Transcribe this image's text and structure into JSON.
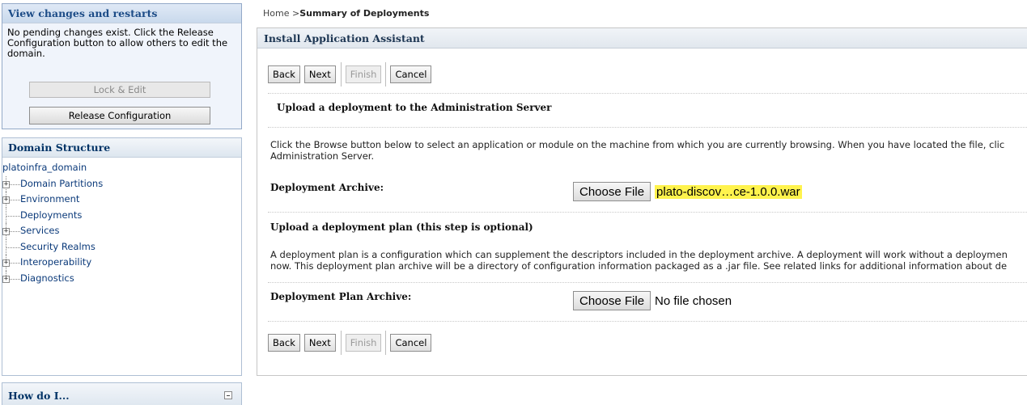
{
  "changes_panel": {
    "title": "View changes and restarts",
    "message_line1": "No pending changes exist. Click the Release",
    "message_line2": "Configuration button to allow others to edit the",
    "message_line3": "domain.",
    "lock_edit_label": "Lock & Edit",
    "release_label": "Release Configuration"
  },
  "domain_structure": {
    "title": "Domain Structure",
    "root": "platoinfra_domain",
    "items": [
      {
        "label": "Domain Partitions",
        "expandable": true
      },
      {
        "label": "Environment",
        "expandable": true
      },
      {
        "label": "Deployments",
        "expandable": false
      },
      {
        "label": "Services",
        "expandable": true
      },
      {
        "label": "Security Realms",
        "expandable": false
      },
      {
        "label": "Interoperability",
        "expandable": true
      },
      {
        "label": "Diagnostics",
        "expandable": true
      }
    ],
    "expander_glyph": "+"
  },
  "how_do_i": {
    "title": "How do I..."
  },
  "breadcrumb": {
    "home": "Home >",
    "current": "Summary of Deployments"
  },
  "assistant": {
    "title": "Install Application Assistant",
    "buttons": {
      "back": "Back",
      "next": "Next",
      "finish": "Finish",
      "cancel": "Cancel"
    },
    "upload_title": "Upload a deployment to the Administration Server",
    "browse_text_line1": "Click the Browse button below to select an application or module on the machine from which you are currently browsing. When you have located the file, clic",
    "browse_text_line2": "Administration Server.",
    "archive_label": "Deployment Archive:",
    "choose_file_label": "Choose File",
    "archive_file": "plato-discov…ce-1.0.0.war",
    "plan_title": "Upload a deployment plan (this step is optional)",
    "plan_text_line1": "A deployment plan is a configuration which can supplement the descriptors included in the deployment archive. A deployment will work without a deploymen",
    "plan_text_line2": "now. This deployment plan archive will be a directory of configuration information packaged as a .jar file. See related links for additional information about de",
    "plan_label": "Deployment Plan Archive:",
    "plan_file": "No file chosen"
  },
  "colors": {
    "highlight": "#fff34d",
    "link": "#0b3a7a",
    "panel_title": "#1c4c87"
  }
}
